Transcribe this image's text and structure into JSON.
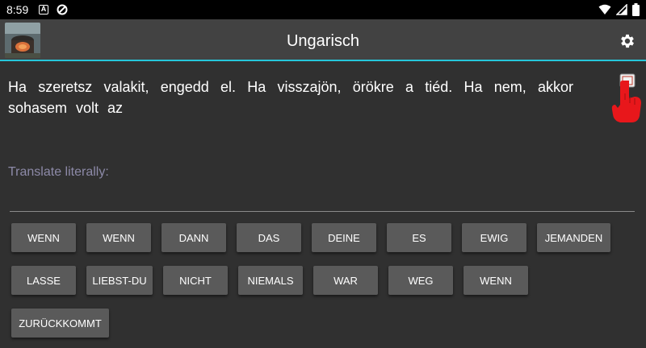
{
  "status": {
    "time": "8:59",
    "a_icon": "A"
  },
  "appbar": {
    "title": "Ungarisch",
    "settings_icon": "gear-icon"
  },
  "sentence": "Ha szeretsz valakit, engedd el. Ha visszajön, örökre a tiéd. Ha nem, akkor sohasem volt az",
  "hint": "Translate literally:",
  "words": [
    "WENN",
    "WENN",
    "DANN",
    "DAS",
    "DEINE",
    "ES",
    "EWIG",
    "JEMANDEN",
    "LASSE",
    "LIEBST-DU",
    "NICHT",
    "NIEMALS",
    "WAR",
    "WEG",
    "WENN",
    "ZURÜCKKOMMT"
  ],
  "colors": {
    "accent": "#26c6da",
    "button": "#5a5a5a",
    "background": "#303030",
    "hint": "#8d8aa8"
  }
}
